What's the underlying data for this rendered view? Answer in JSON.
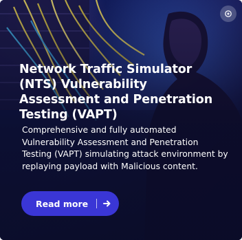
{
  "card": {
    "title": "Network Traffic Simulator (NTS) Vulnerability Assessment and Penetration Testing (VAPT)",
    "description": "Comprehensive and fully automated Vulnerability Assessment and Penetration Testing (VAPT) simulating attack environment by replaying payload with Malicious content.",
    "read_more_label": "Read more"
  },
  "colors": {
    "button": "#3a36d6",
    "overlay": "#0d0f2a",
    "text": "#ffffff"
  },
  "icons": {
    "corner": "settings-badge-icon",
    "button": "arrow-right-icon"
  }
}
